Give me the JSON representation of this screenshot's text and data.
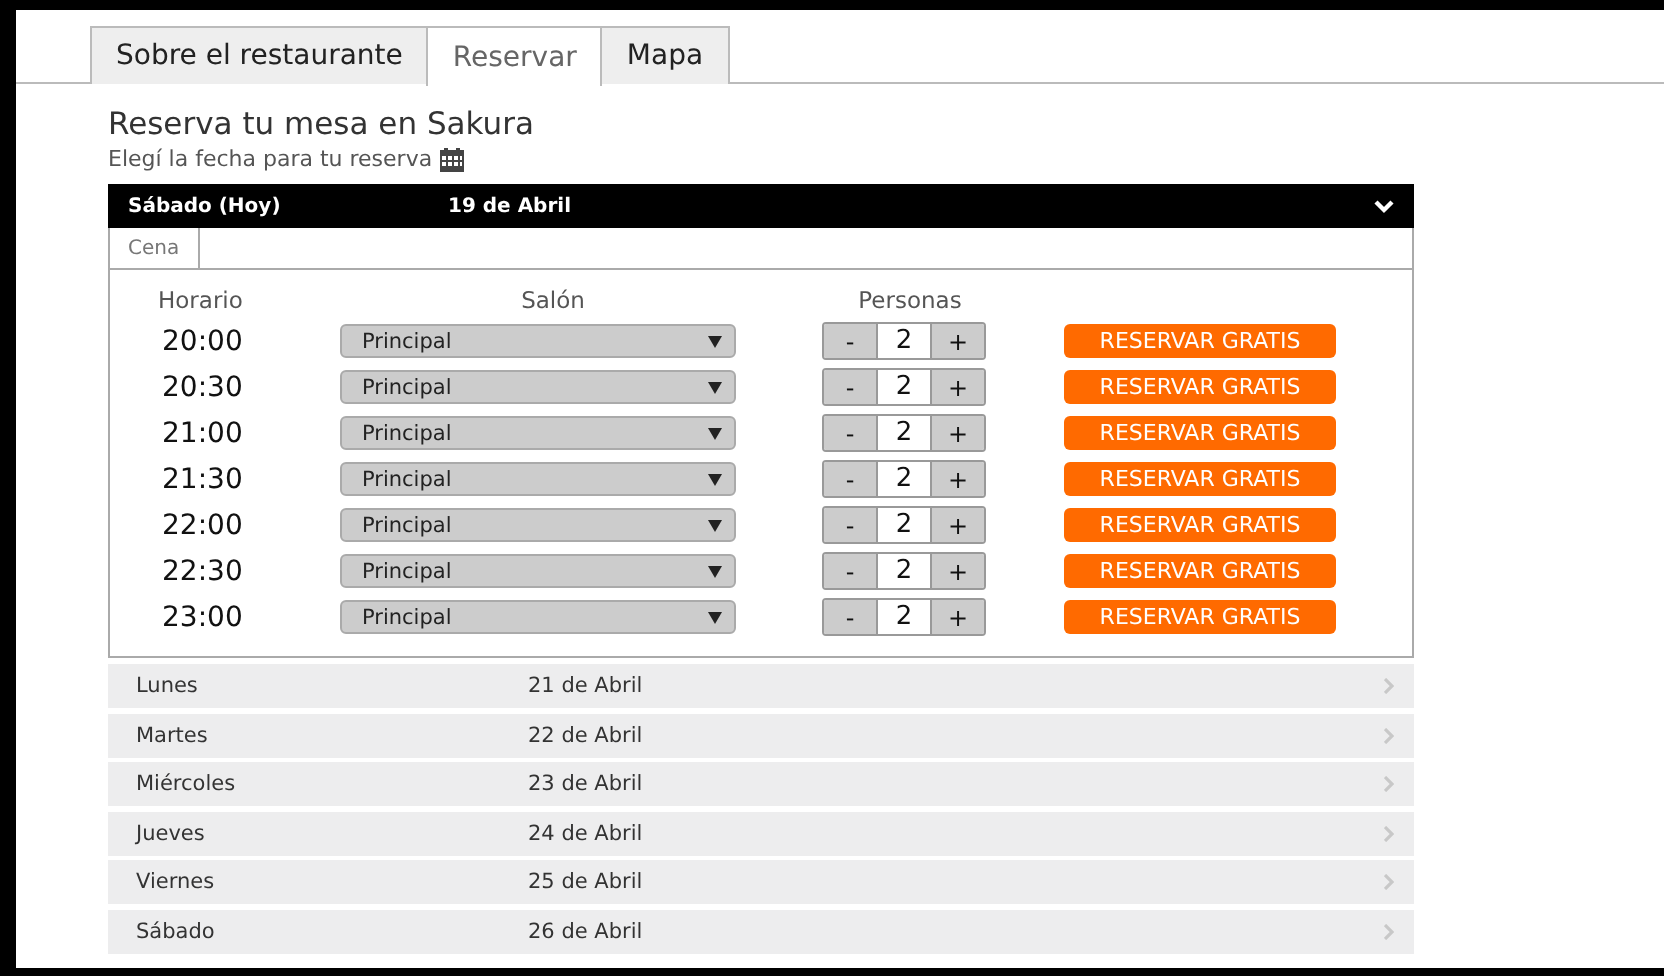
{
  "tabs": [
    {
      "label": "Sobre el restaurante",
      "selected": false
    },
    {
      "label": "Reservar",
      "selected": true
    },
    {
      "label": "Mapa",
      "selected": false
    }
  ],
  "heading": "Reserva tu mesa en Sakura",
  "subheading": "Elegí la fecha para tu reserva",
  "days": [
    {
      "day": "Sábado (Hoy)",
      "date": "19 de Abril",
      "expanded": true,
      "meals": [
        {
          "label": "Cena",
          "selected": true
        }
      ],
      "columns": [
        "Horario",
        "Salón",
        "Personas"
      ],
      "slots": [
        {
          "time": "20:00",
          "room": "Principal",
          "minus": "-",
          "people": "2",
          "plus": "+",
          "action": "RESERVAR GRATIS"
        },
        {
          "time": "20:30",
          "room": "Principal",
          "minus": "-",
          "people": "2",
          "plus": "+",
          "action": "RESERVAR GRATIS"
        },
        {
          "time": "21:00",
          "room": "Principal",
          "minus": "-",
          "people": "2",
          "plus": "+",
          "action": "RESERVAR GRATIS"
        },
        {
          "time": "21:30",
          "room": "Principal",
          "minus": "-",
          "people": "2",
          "plus": "+",
          "action": "RESERVAR GRATIS"
        },
        {
          "time": "22:00",
          "room": "Principal",
          "minus": "-",
          "people": "2",
          "plus": "+",
          "action": "RESERVAR GRATIS"
        },
        {
          "time": "22:30",
          "room": "Principal",
          "minus": "-",
          "people": "2",
          "plus": "+",
          "action": "RESERVAR GRATIS"
        },
        {
          "time": "23:00",
          "room": "Principal",
          "minus": "-",
          "people": "2",
          "plus": "+",
          "action": "RESERVAR GRATIS"
        }
      ]
    },
    {
      "day": "Lunes",
      "date": "21 de Abril",
      "expanded": false
    },
    {
      "day": "Martes",
      "date": "22 de Abril",
      "expanded": false
    },
    {
      "day": "Miércoles",
      "date": "23 de Abril",
      "expanded": false
    },
    {
      "day": "Jueves",
      "date": "24 de Abril",
      "expanded": false
    },
    {
      "day": "Viernes",
      "date": "25 de Abril",
      "expanded": false
    },
    {
      "day": "Sábado",
      "date": "26 de Abril",
      "expanded": false
    }
  ]
}
